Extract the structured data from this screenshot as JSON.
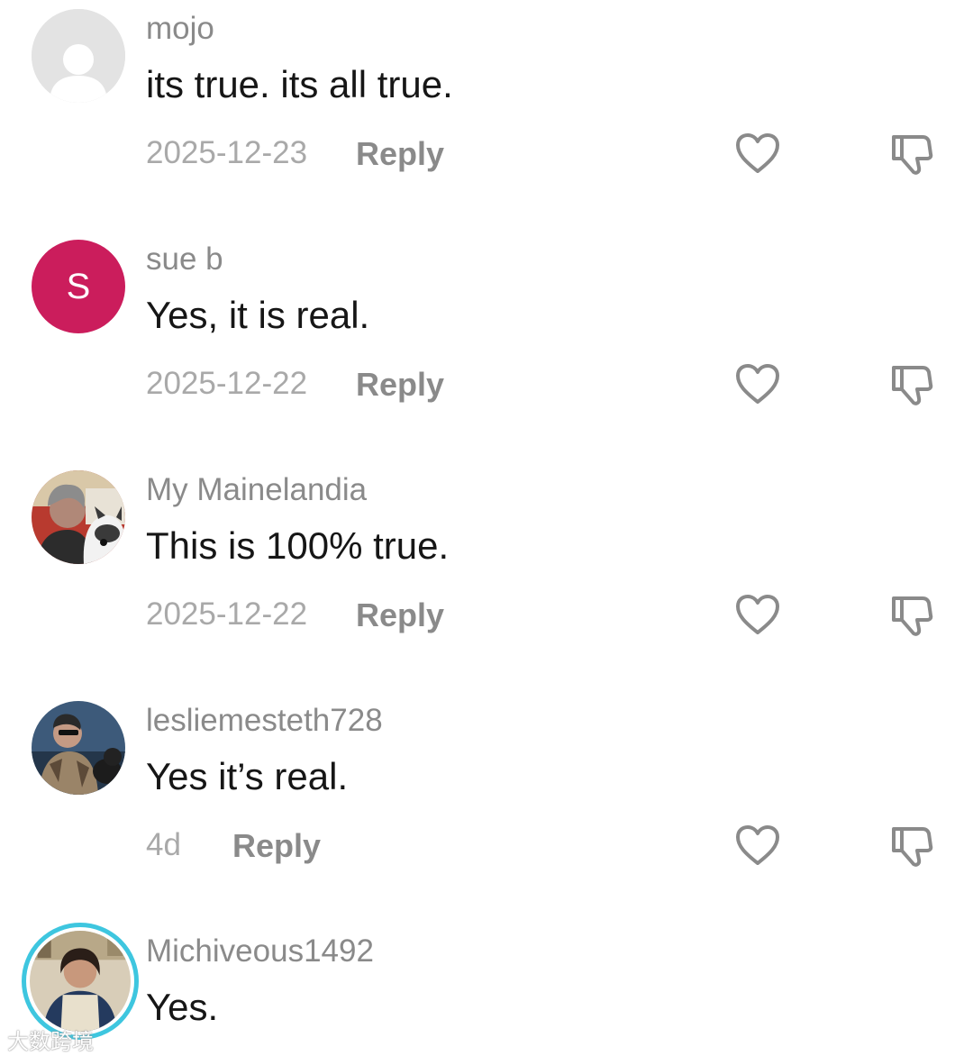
{
  "comments": [
    {
      "username": "mojo",
      "text": "its true. its all true.",
      "date": "2025-12-23",
      "reply_label": "Reply",
      "avatar": "default-avatar"
    },
    {
      "username": "sue b",
      "text": "Yes, it is real.",
      "date": "2025-12-22",
      "reply_label": "Reply",
      "avatar": "letter",
      "avatar_letter": "S",
      "avatar_color": "#cb1d5c"
    },
    {
      "username": "My Mainelandia",
      "text": "This is 100% true.",
      "date": "2025-12-22",
      "reply_label": "Reply",
      "avatar": "photo"
    },
    {
      "username": "lesliemesteth728",
      "text": "Yes it’s real.",
      "date": "4d",
      "reply_label": "Reply",
      "avatar": "photo"
    },
    {
      "username": "Michiveous1492",
      "text": "Yes.",
      "avatar": "photo-with-story-ring",
      "ring_color": "#3ec6df"
    }
  ],
  "icons": {
    "like": "heart-icon",
    "dislike": "thumbs-down-icon"
  },
  "watermark": "大数跨境"
}
